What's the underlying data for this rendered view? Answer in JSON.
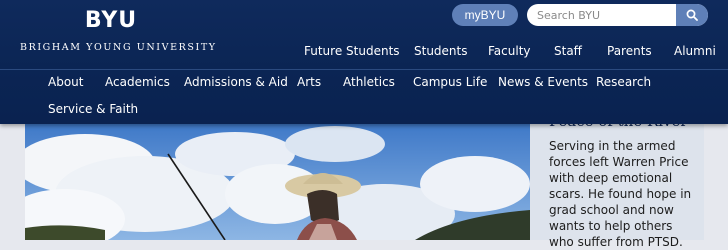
{
  "logo": {
    "mark": "BYU",
    "text": "BRIGHAM YOUNG UNIVERSITY"
  },
  "top": {
    "mybyu_label": "myBYU",
    "search_placeholder": "Search BYU",
    "search_icon": "search-icon"
  },
  "audience_nav": [
    "Future Students",
    "Students",
    "Faculty",
    "Staff",
    "Parents",
    "Alumni"
  ],
  "main_nav": [
    "About",
    "Academics",
    "Admissions & Aid",
    "Arts",
    "Athletics",
    "Campus Life",
    "News & Events",
    "Research",
    "Service & Faith"
  ],
  "feature": {
    "title": "Peace of the River",
    "body": "Serving in the armed forces left Warren Price with deep emotional scars. He found hope in grad school and now wants to help others who suffer from PTSD."
  },
  "colors": {
    "header_bg": "#0b2554",
    "button_bg": "#5f80b8",
    "sidebar_bg": "#dde3ec"
  }
}
